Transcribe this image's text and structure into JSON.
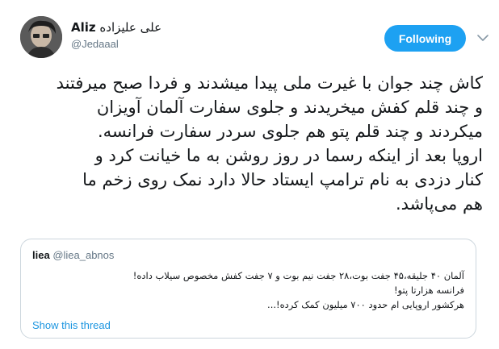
{
  "tweet": {
    "author": {
      "display_name": "Aliz",
      "display_name_fa": "علی علیزاده",
      "handle": "@Jedaaal"
    },
    "follow_label": "Following",
    "text_lines": [
      "کاش چند جوان با غیرت ملی پیدا میشدند و فردا صبح میرفتند",
      "و چند قلم کفش میخریدند و  جلوی سفارت آلمان آویزان",
      "میکردند و چند قلم پتو هم جلوی سردر سفارت فرانسه.",
      "اروپا بعد از اینکه رسما در روز روشن به ما خیانت کرد و",
      "کنار  دزدی به نام ترامپ ایستاد حالا دارد نمک روی زخم ما",
      "هم می‌پاشد."
    ]
  },
  "quoted_tweet": {
    "name": "liea",
    "handle": "@liea_abnos",
    "text_lines": [
      "آلمان ۴۰ جلیقه،۴۵ جفت بوت،۲۸ جفت نیم بوت و ۷ جفت کفش مخصوص سیلاب داده!",
      "فرانسه هزارتا پتو!",
      "هرکشور اروپایی ام حدود ۷۰۰ میلیون کمک کرده!..."
    ],
    "show_thread_label": "Show this thread"
  },
  "colors": {
    "accent": "#1da1f2",
    "link": "#1b95e0",
    "secondary_text": "#657786",
    "border": "#ccd6dd"
  },
  "icons": {
    "avatar": "avatar",
    "menu": "chevron-down-icon"
  }
}
